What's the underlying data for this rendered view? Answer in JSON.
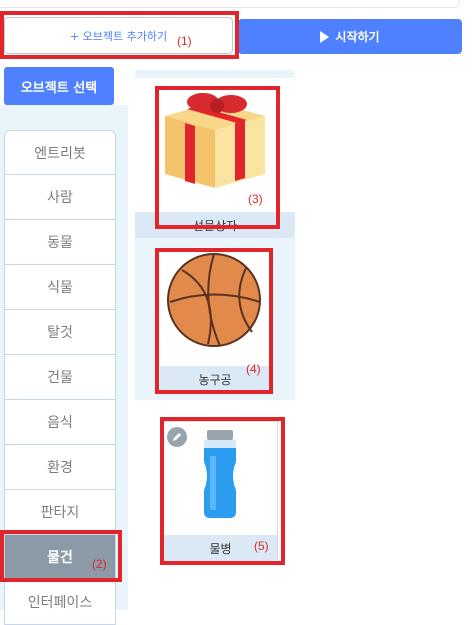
{
  "toolbar": {
    "add_object_label": "+ 오브젝트 추가하기",
    "start_label": "시작하기"
  },
  "selection": {
    "tab_label": "오브젝트 선택",
    "categories": [
      "엔트리봇",
      "사람",
      "동물",
      "식물",
      "탈것",
      "건물",
      "음식",
      "환경",
      "판타지",
      "물건",
      "인터페이스"
    ],
    "active_category": "물건"
  },
  "objects": [
    {
      "name": "선물상자",
      "icon": "gift-box-icon"
    },
    {
      "name": "농구공",
      "icon": "basketball-icon"
    },
    {
      "name": "물병",
      "icon": "water-bottle-icon"
    }
  ],
  "annotations": [
    "(1)",
    "(2)",
    "(3)",
    "(4)",
    "(5)"
  ],
  "colors": {
    "accent": "#4f80ff",
    "highlight_border": "#e0262b",
    "panel_bg": "#eaf4fb",
    "active_category_bg": "#8c9aa7"
  }
}
